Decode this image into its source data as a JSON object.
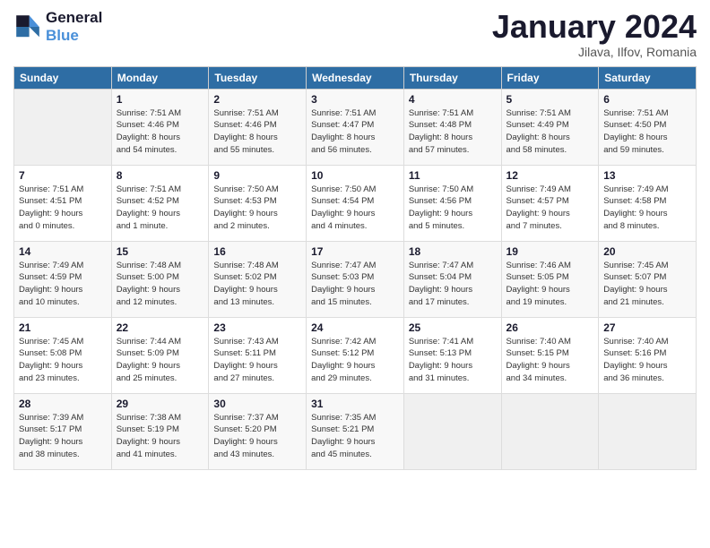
{
  "header": {
    "logo_line1": "General",
    "logo_line2": "Blue",
    "month_title": "January 2024",
    "subtitle": "Jilava, Ilfov, Romania"
  },
  "weekdays": [
    "Sunday",
    "Monday",
    "Tuesday",
    "Wednesday",
    "Thursday",
    "Friday",
    "Saturday"
  ],
  "weeks": [
    [
      {
        "day": "",
        "info": ""
      },
      {
        "day": "1",
        "info": "Sunrise: 7:51 AM\nSunset: 4:46 PM\nDaylight: 8 hours\nand 54 minutes."
      },
      {
        "day": "2",
        "info": "Sunrise: 7:51 AM\nSunset: 4:46 PM\nDaylight: 8 hours\nand 55 minutes."
      },
      {
        "day": "3",
        "info": "Sunrise: 7:51 AM\nSunset: 4:47 PM\nDaylight: 8 hours\nand 56 minutes."
      },
      {
        "day": "4",
        "info": "Sunrise: 7:51 AM\nSunset: 4:48 PM\nDaylight: 8 hours\nand 57 minutes."
      },
      {
        "day": "5",
        "info": "Sunrise: 7:51 AM\nSunset: 4:49 PM\nDaylight: 8 hours\nand 58 minutes."
      },
      {
        "day": "6",
        "info": "Sunrise: 7:51 AM\nSunset: 4:50 PM\nDaylight: 8 hours\nand 59 minutes."
      }
    ],
    [
      {
        "day": "7",
        "info": "Sunrise: 7:51 AM\nSunset: 4:51 PM\nDaylight: 9 hours\nand 0 minutes."
      },
      {
        "day": "8",
        "info": "Sunrise: 7:51 AM\nSunset: 4:52 PM\nDaylight: 9 hours\nand 1 minute."
      },
      {
        "day": "9",
        "info": "Sunrise: 7:50 AM\nSunset: 4:53 PM\nDaylight: 9 hours\nand 2 minutes."
      },
      {
        "day": "10",
        "info": "Sunrise: 7:50 AM\nSunset: 4:54 PM\nDaylight: 9 hours\nand 4 minutes."
      },
      {
        "day": "11",
        "info": "Sunrise: 7:50 AM\nSunset: 4:56 PM\nDaylight: 9 hours\nand 5 minutes."
      },
      {
        "day": "12",
        "info": "Sunrise: 7:49 AM\nSunset: 4:57 PM\nDaylight: 9 hours\nand 7 minutes."
      },
      {
        "day": "13",
        "info": "Sunrise: 7:49 AM\nSunset: 4:58 PM\nDaylight: 9 hours\nand 8 minutes."
      }
    ],
    [
      {
        "day": "14",
        "info": "Sunrise: 7:49 AM\nSunset: 4:59 PM\nDaylight: 9 hours\nand 10 minutes."
      },
      {
        "day": "15",
        "info": "Sunrise: 7:48 AM\nSunset: 5:00 PM\nDaylight: 9 hours\nand 12 minutes."
      },
      {
        "day": "16",
        "info": "Sunrise: 7:48 AM\nSunset: 5:02 PM\nDaylight: 9 hours\nand 13 minutes."
      },
      {
        "day": "17",
        "info": "Sunrise: 7:47 AM\nSunset: 5:03 PM\nDaylight: 9 hours\nand 15 minutes."
      },
      {
        "day": "18",
        "info": "Sunrise: 7:47 AM\nSunset: 5:04 PM\nDaylight: 9 hours\nand 17 minutes."
      },
      {
        "day": "19",
        "info": "Sunrise: 7:46 AM\nSunset: 5:05 PM\nDaylight: 9 hours\nand 19 minutes."
      },
      {
        "day": "20",
        "info": "Sunrise: 7:45 AM\nSunset: 5:07 PM\nDaylight: 9 hours\nand 21 minutes."
      }
    ],
    [
      {
        "day": "21",
        "info": "Sunrise: 7:45 AM\nSunset: 5:08 PM\nDaylight: 9 hours\nand 23 minutes."
      },
      {
        "day": "22",
        "info": "Sunrise: 7:44 AM\nSunset: 5:09 PM\nDaylight: 9 hours\nand 25 minutes."
      },
      {
        "day": "23",
        "info": "Sunrise: 7:43 AM\nSunset: 5:11 PM\nDaylight: 9 hours\nand 27 minutes."
      },
      {
        "day": "24",
        "info": "Sunrise: 7:42 AM\nSunset: 5:12 PM\nDaylight: 9 hours\nand 29 minutes."
      },
      {
        "day": "25",
        "info": "Sunrise: 7:41 AM\nSunset: 5:13 PM\nDaylight: 9 hours\nand 31 minutes."
      },
      {
        "day": "26",
        "info": "Sunrise: 7:40 AM\nSunset: 5:15 PM\nDaylight: 9 hours\nand 34 minutes."
      },
      {
        "day": "27",
        "info": "Sunrise: 7:40 AM\nSunset: 5:16 PM\nDaylight: 9 hours\nand 36 minutes."
      }
    ],
    [
      {
        "day": "28",
        "info": "Sunrise: 7:39 AM\nSunset: 5:17 PM\nDaylight: 9 hours\nand 38 minutes."
      },
      {
        "day": "29",
        "info": "Sunrise: 7:38 AM\nSunset: 5:19 PM\nDaylight: 9 hours\nand 41 minutes."
      },
      {
        "day": "30",
        "info": "Sunrise: 7:37 AM\nSunset: 5:20 PM\nDaylight: 9 hours\nand 43 minutes."
      },
      {
        "day": "31",
        "info": "Sunrise: 7:35 AM\nSunset: 5:21 PM\nDaylight: 9 hours\nand 45 minutes."
      },
      {
        "day": "",
        "info": ""
      },
      {
        "day": "",
        "info": ""
      },
      {
        "day": "",
        "info": ""
      }
    ]
  ]
}
